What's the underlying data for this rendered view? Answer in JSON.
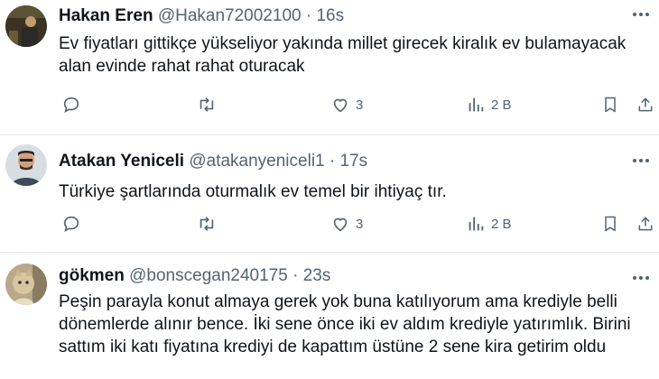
{
  "tweets": [
    {
      "name": "Hakan Eren",
      "handle": "@Hakan72002100",
      "separator": "·",
      "time": "16s",
      "text": "Ev fiyatları gittikçe yükseliyor yakında millet girecek kiralık ev bulamayacak\nalan evinde rahat rahat oturacak",
      "likes": "3",
      "views": "2 B"
    },
    {
      "name": "Atakan Yeniceli",
      "handle": "@atakanyeniceli1",
      "separator": "·",
      "time": "17s",
      "text": "Türkiye şartlarında oturmalık ev temel bir ihtiyaç tır.",
      "likes": "3",
      "views": "2 B"
    },
    {
      "name": "gökmen",
      "handle": "@bonscegan240175",
      "separator": "·",
      "time": "23s",
      "text": "Peşin parayla konut almaya gerek yok buna katılıyorum ama krediyle belli\ndönemlerde alınır bence. İki sene önce iki ev aldım krediyle yatırımlık. Birini\nsattım iki katı fiyatına krediyi de kapattım üstüne 2 sene kira getirim oldu"
    }
  ],
  "icons": {
    "reply": "reply-icon",
    "retweet": "retweet-icon",
    "like": "heart-icon",
    "views": "views-icon",
    "bookmark": "bookmark-icon",
    "share": "share-icon",
    "more": "more-icon"
  },
  "colors": {
    "text": "#0f1419",
    "secondary": "#536471",
    "divider": "#e6e9ec"
  }
}
